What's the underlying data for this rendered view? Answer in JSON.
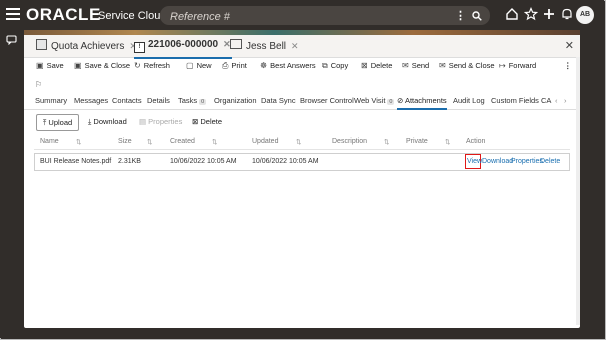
{
  "brand": {
    "logo": "ORACLE",
    "product": "Service Cloud"
  },
  "search": {
    "placeholder": "Reference #"
  },
  "user": {
    "initials": "AB"
  },
  "record_tabs": [
    {
      "label": "Quota Achievers",
      "active": false
    },
    {
      "label": "221006-000000",
      "active": true
    },
    {
      "label": "Jess Bell",
      "active": false
    }
  ],
  "toolbar": {
    "save": "Save",
    "save_close": "Save & Close",
    "refresh": "Refresh",
    "new": "New",
    "print": "Print",
    "best_answers": "Best Answers",
    "copy": "Copy",
    "delete": "Delete",
    "send": "Send",
    "send_close": "Send & Close",
    "forward": "Forward"
  },
  "subtabs": [
    {
      "label": "Summary"
    },
    {
      "label": "Messages"
    },
    {
      "label": "Contacts"
    },
    {
      "label": "Details"
    },
    {
      "label": "Tasks",
      "badge": "0"
    },
    {
      "label": "Organization"
    },
    {
      "label": "Data Sync"
    },
    {
      "label": "Browser Control"
    },
    {
      "label": "Web Visit",
      "badge": "0"
    },
    {
      "label": "Attachments",
      "active": true
    },
    {
      "label": "Audit Log"
    },
    {
      "label": "Custom Fields"
    },
    {
      "label": "CA"
    }
  ],
  "attach_toolbar": {
    "upload": "Upload",
    "download": "Download",
    "properties": "Properties",
    "delete": "Delete"
  },
  "table": {
    "headers": {
      "name": "Name",
      "size": "Size",
      "created": "Created",
      "updated": "Updated",
      "description": "Description",
      "private": "Private",
      "action": "Action"
    },
    "rows": [
      {
        "name": "BUI Release Notes.pdf",
        "size": "2.31KB",
        "created": "10/06/2022 10:05 AM",
        "updated": "10/06/2022 10:05 AM",
        "description": "",
        "private": "",
        "actions": {
          "view": "View",
          "download": "Download",
          "properties": "Properties",
          "delete": "Delete"
        }
      }
    ]
  },
  "colors": {
    "topbar": "#312d2a",
    "accent": "#1b6dac",
    "link": "#1a6fb0",
    "highlight": "#e01818"
  }
}
